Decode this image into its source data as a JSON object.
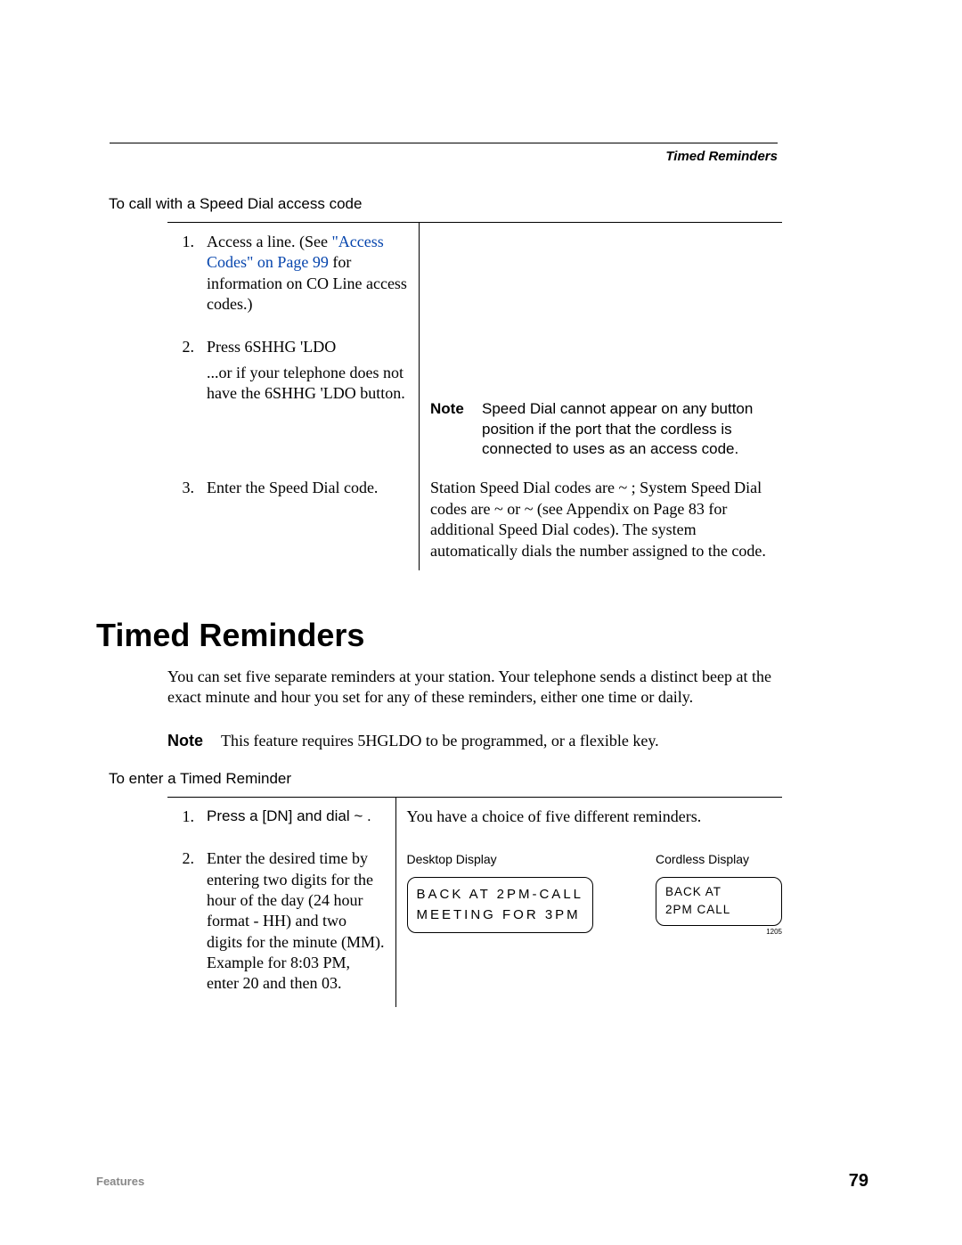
{
  "header": {
    "running_title": "Timed Reminders"
  },
  "section1": {
    "subheading": "To call with a Speed Dial access code",
    "steps": [
      {
        "num": "1.",
        "prefix": "Access a line. (See ",
        "link": "\"Access Codes\" on Page 99",
        "suffix": " for information on CO Line access codes.)",
        "right": ""
      },
      {
        "num": "2.",
        "line1": "Press 6SHHG 'LDO",
        "line2": "...or    if your telephone does not have the 6SHHG 'LDO button.",
        "right_note_label": "Note",
        "right_note_body": "Speed Dial cannot appear on any button position if the port that the cordless is connected to uses as an access code."
      },
      {
        "num": "3.",
        "body": "Enter the Speed Dial code.",
        "right": "Station Speed Dial codes are      ~     ; System Speed Dial codes are       ~       or    ~      (see Appendix on Page 83 for additional Speed Dial codes). The system automatically dials the number assigned to the code."
      }
    ]
  },
  "section2": {
    "title": "Timed Reminders",
    "intro": "You can set five separate reminders at your station. Your telephone sends a distinct beep at the exact minute and hour you set for any of these reminders, either one time or daily.",
    "note_label": "Note",
    "note_body": "This feature requires 5HGLDO to be programmed, or a flexible key.",
    "subheading": "To enter a Timed Reminder",
    "steps": [
      {
        "num": "1.",
        "body": "Press a [DN] and dial       ~       .",
        "right": "You have a choice of five different reminders."
      },
      {
        "num": "2.",
        "body": "Enter the desired time by entering two digits for the hour of the day (24 hour format - HH) and two digits for the minute (MM).\nExample for 8:03 PM, enter 20 and then 03.",
        "display_desktop_label": "Desktop Display",
        "display_desktop_line1": "BACK AT 2PM-CALL",
        "display_desktop_line2": "MEETING FOR 3PM",
        "display_cordless_label": "Cordless Display",
        "display_cordless_line1": "BACK AT",
        "display_cordless_line2": "2PM CALL",
        "tiny": "1205"
      }
    ]
  },
  "footer": {
    "left": "Features",
    "page": "79"
  }
}
